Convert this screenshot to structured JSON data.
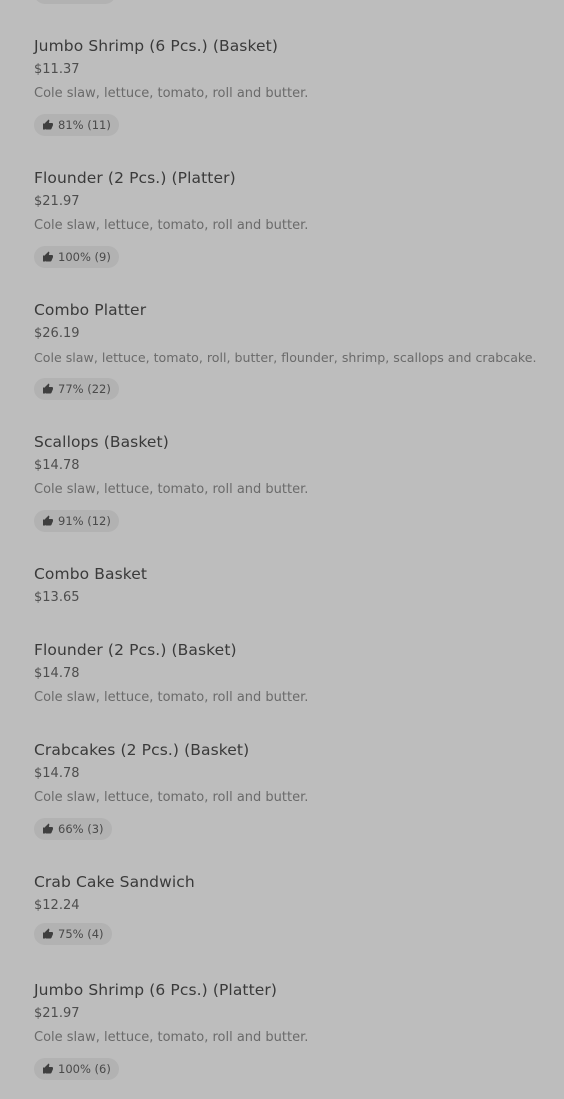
{
  "menu": {
    "items": [
      {
        "name": "Jumbo Shrimp (6 Pcs.) (Basket)",
        "price": "$11.37",
        "description": "Cole slaw, lettuce, tomato, roll and butter.",
        "rating": "81% (11)"
      },
      {
        "name": "Flounder (2 Pcs.) (Platter)",
        "price": "$21.97",
        "description": "Cole slaw, lettuce, tomato, roll and butter.",
        "rating": "100% (9)"
      },
      {
        "name": "Combo Platter",
        "price": "$26.19",
        "description": "Cole slaw, lettuce, tomato, roll, butter, flounder, shrimp, scallops and crabcake.",
        "rating": "77% (22)"
      },
      {
        "name": "Scallops (Basket)",
        "price": "$14.78",
        "description": "Cole slaw, lettuce, tomato, roll and butter.",
        "rating": "91% (12)"
      },
      {
        "name": "Combo Basket",
        "price": "$13.65"
      },
      {
        "name": "Flounder (2 Pcs.) (Basket)",
        "price": "$14.78",
        "description": "Cole slaw, lettuce, tomato, roll and butter."
      },
      {
        "name": "Crabcakes (2 Pcs.) (Basket)",
        "price": "$14.78",
        "description": "Cole slaw, lettuce, tomato, roll and butter.",
        "rating": "66% (3)"
      },
      {
        "name": "Crab Cake Sandwich",
        "price": "$12.24",
        "rating": "75% (4)"
      },
      {
        "name": "Jumbo Shrimp (6 Pcs.) (Platter)",
        "price": "$21.97",
        "description": "Cole slaw, lettuce, tomato, roll and butter.",
        "rating": "100% (6)"
      }
    ],
    "rating_icon": "thumbs-up-icon"
  }
}
